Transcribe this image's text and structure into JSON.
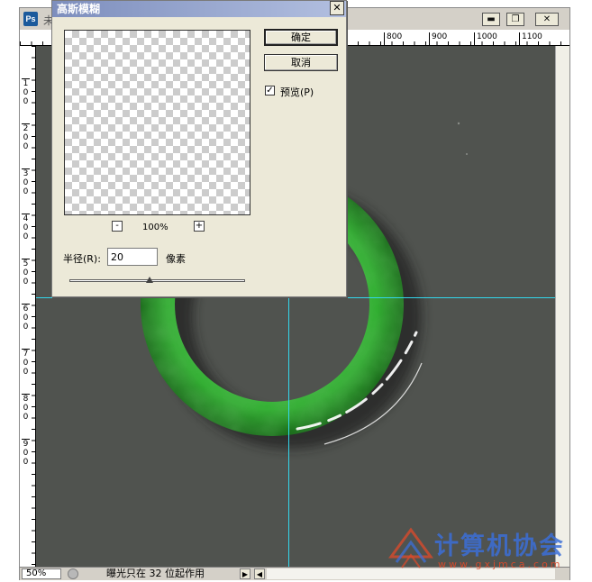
{
  "document_window": {
    "title": "未",
    "app_icon": "Ps",
    "buttons": {
      "minimize": "▬",
      "restore": "❐",
      "close": "✕"
    }
  },
  "ruler": {
    "top_ticks": [
      "800",
      "900",
      "1000",
      "1100"
    ],
    "left_ticks": [
      "100",
      "200",
      "300",
      "400",
      "500",
      "600",
      "700",
      "800",
      "900"
    ]
  },
  "status_bar": {
    "zoom": "50%",
    "text": "曝光只在 32 位起作用"
  },
  "dialog": {
    "title": "高斯模糊",
    "close_glyph": "✕",
    "ok_label": "确定",
    "cancel_label": "取消",
    "preview_label": "预览(P)",
    "preview_checked": true,
    "zoom_out": "-",
    "zoom_in": "+",
    "zoom_level": "100%",
    "radius_label": "半径(R):",
    "radius_value": "20",
    "radius_unit": "像素"
  },
  "watermark": {
    "title": "计算机协会",
    "url": "www.gxjmca.com"
  },
  "colors": {
    "canvas": "#50534f",
    "guide": "#33d6ec",
    "ring": "#35b335"
  }
}
